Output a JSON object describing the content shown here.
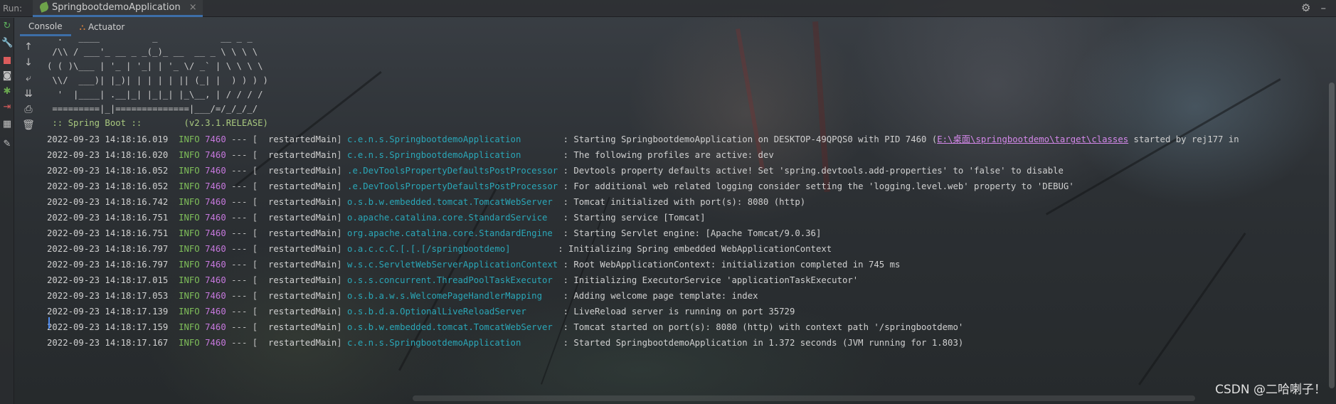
{
  "runbar": {
    "label": "Run:",
    "tab_title": "SpringbootdemoApplication",
    "close_glyph": "×",
    "settings_icon": "gear-icon",
    "hide_icon": "minimize-icon"
  },
  "subtabs": {
    "console": "Console",
    "actuator": "Actuator"
  },
  "gutter_icons": [
    "rerun-icon",
    "wrench-icon",
    "stop-icon",
    "camera-icon",
    "debug-icon",
    "exit-icon",
    "layout-icon",
    "pin-icon"
  ],
  "toolbar_icons": [
    "arrow-up-icon",
    "arrow-down-icon",
    "soft-wrap-icon",
    "scroll-to-end-icon",
    "print-icon",
    "trash-icon"
  ],
  "banner": [
    "  .   ____          _            __ _ _",
    " /\\\\ / ___'_ __ _ _(_)_ __  __ _ \\ \\ \\ \\",
    "( ( )\\___ | '_ | '_| | '_ \\/ _` | \\ \\ \\ \\",
    " \\\\/  ___)| |_)| | | | | || (_| |  ) ) ) )",
    "  '  |____| .__|_| |_|_| |_\\__, | / / / /",
    " =========|_|==============|___/=/_/_/_/",
    " :: Spring Boot ::        (v2.3.1.RELEASE)"
  ],
  "logs": [
    {
      "date": "2022-09-23 14:18:16.019",
      "level": "INFO",
      "pid": "7460",
      "thread": "restartedMain",
      "logger": "c.e.n.s.SpringbootdemoApplication       ",
      "msg": ": Starting SpringbootdemoApplication on DESKTOP-49QPQS0 with PID 7460 (",
      "link": "E:\\桌面\\springbootdemo\\target\\classes",
      "tail": " started by rej177 in"
    },
    {
      "date": "2022-09-23 14:18:16.020",
      "level": "INFO",
      "pid": "7460",
      "thread": "restartedMain",
      "logger": "c.e.n.s.SpringbootdemoApplication       ",
      "msg": ": The following profiles are active: dev"
    },
    {
      "date": "2022-09-23 14:18:16.052",
      "level": "INFO",
      "pid": "7460",
      "thread": "restartedMain",
      "logger": ".e.DevToolsPropertyDefaultsPostProcessor",
      "msg": ": Devtools property defaults active! Set 'spring.devtools.add-properties' to 'false' to disable"
    },
    {
      "date": "2022-09-23 14:18:16.052",
      "level": "INFO",
      "pid": "7460",
      "thread": "restartedMain",
      "logger": ".e.DevToolsPropertyDefaultsPostProcessor",
      "msg": ": For additional web related logging consider setting the 'logging.level.web' property to 'DEBUG'"
    },
    {
      "date": "2022-09-23 14:18:16.742",
      "level": "INFO",
      "pid": "7460",
      "thread": "restartedMain",
      "logger": "o.s.b.w.embedded.tomcat.TomcatWebServer ",
      "msg": ": Tomcat initialized with port(s): 8080 (http)"
    },
    {
      "date": "2022-09-23 14:18:16.751",
      "level": "INFO",
      "pid": "7460",
      "thread": "restartedMain",
      "logger": "o.apache.catalina.core.StandardService  ",
      "msg": ": Starting service [Tomcat]"
    },
    {
      "date": "2022-09-23 14:18:16.751",
      "level": "INFO",
      "pid": "7460",
      "thread": "restartedMain",
      "logger": "org.apache.catalina.core.StandardEngine ",
      "msg": ": Starting Servlet engine: [Apache Tomcat/9.0.36]"
    },
    {
      "date": "2022-09-23 14:18:16.797",
      "level": "INFO",
      "pid": "7460",
      "thread": "restartedMain",
      "logger": "o.a.c.c.C.[.[.[/springbootdemo]        ",
      "msg": ": Initializing Spring embedded WebApplicationContext"
    },
    {
      "date": "2022-09-23 14:18:16.797",
      "level": "INFO",
      "pid": "7460",
      "thread": "restartedMain",
      "logger": "w.s.c.ServletWebServerApplicationContext",
      "msg": ": Root WebApplicationContext: initialization completed in 745 ms"
    },
    {
      "date": "2022-09-23 14:18:17.015",
      "level": "INFO",
      "pid": "7460",
      "thread": "restartedMain",
      "logger": "o.s.s.concurrent.ThreadPoolTaskExecutor ",
      "msg": ": Initializing ExecutorService 'applicationTaskExecutor'"
    },
    {
      "date": "2022-09-23 14:18:17.053",
      "level": "INFO",
      "pid": "7460",
      "thread": "restartedMain",
      "logger": "o.s.b.a.w.s.WelcomePageHandlerMapping   ",
      "msg": ": Adding welcome page template: index"
    },
    {
      "date": "2022-09-23 14:18:17.139",
      "level": "INFO",
      "pid": "7460",
      "thread": "restartedMain",
      "logger": "o.s.b.d.a.OptionalLiveReloadServer      ",
      "msg": ": LiveReload server is running on port 35729"
    },
    {
      "date": "2022-09-23 14:18:17.159",
      "level": "INFO",
      "pid": "7460",
      "thread": "restartedMain",
      "logger": "o.s.b.w.embedded.tomcat.TomcatWebServer ",
      "msg": ": Tomcat started on port(s): 8080 (http) with context path '/springbootdemo'"
    },
    {
      "date": "2022-09-23 14:18:17.167",
      "level": "INFO",
      "pid": "7460",
      "thread": "restartedMain",
      "logger": "c.e.n.s.SpringbootdemoApplication       ",
      "msg": ": Started SpringbootdemoApplication in 1.372 seconds (JVM running for 1.803)"
    }
  ],
  "watermark": "CSDN @二哈喇子！",
  "colors": {
    "info": "#7fbf5a",
    "pid": "#c678dd",
    "logger": "#2aa7b8",
    "link": "#d488ea",
    "accent": "#3d6ea8"
  }
}
